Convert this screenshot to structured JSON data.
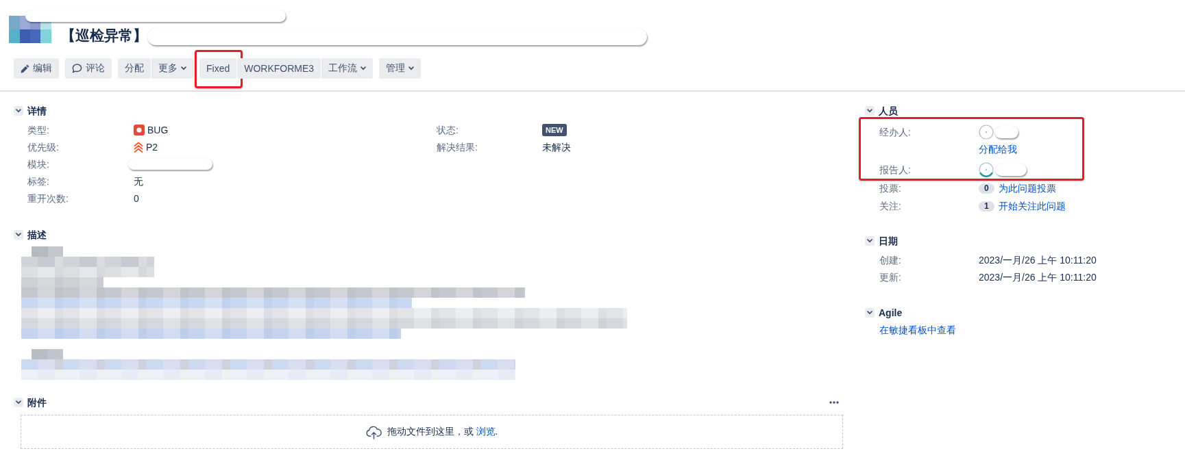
{
  "issue": {
    "title": "【巡检异常】"
  },
  "toolbar": {
    "groups": [
      {
        "buttons": [
          {
            "kind": "edit",
            "label": "编辑",
            "highlighted": false
          }
        ]
      },
      {
        "buttons": [
          {
            "kind": "comment",
            "label": "评论",
            "highlighted": false
          }
        ]
      },
      {
        "buttons": [
          {
            "kind": "plain",
            "label": "分配",
            "highlighted": false
          },
          {
            "kind": "dropdown",
            "label": "更多",
            "highlighted": false
          }
        ]
      },
      {
        "buttons": [
          {
            "kind": "plain",
            "label": "Fixed",
            "highlighted": true
          },
          {
            "kind": "plain",
            "label": "WORKFORME3",
            "highlighted": false
          },
          {
            "kind": "dropdown",
            "label": "工作流",
            "highlighted": false
          }
        ]
      },
      {
        "buttons": [
          {
            "kind": "dropdown",
            "label": "管理",
            "highlighted": false
          }
        ]
      }
    ]
  },
  "details": {
    "title": "详情",
    "expanded": true,
    "left_fields": [
      {
        "label": "类型:",
        "kind": "issue_type",
        "value": "BUG"
      },
      {
        "label": "优先级:",
        "kind": "priority",
        "value": "P2"
      },
      {
        "label": "模块:",
        "kind": "redacted"
      },
      {
        "label": "标签:",
        "kind": "text",
        "value": "无"
      },
      {
        "label": "重开次数:",
        "kind": "text",
        "value": "0"
      }
    ],
    "right_fields": [
      {
        "label": "状态:",
        "kind": "lozenge",
        "value": "NEW"
      },
      {
        "label": "解决结果:",
        "kind": "text",
        "value": "未解决"
      }
    ]
  },
  "description": {
    "title": "描述",
    "expanded": true
  },
  "attachments": {
    "title": "附件",
    "expanded": true,
    "dropzone": {
      "text": "拖动文件到这里，或",
      "link": "浏览."
    }
  },
  "people": {
    "title": "人员",
    "expanded": true,
    "highlighted": true,
    "assignee": {
      "label": "经办人:",
      "action": "分配给我"
    },
    "reporter": {
      "label": "报告人:"
    },
    "votes": {
      "label": "投票:",
      "count": "0",
      "action": "为此问题投票"
    },
    "watchers": {
      "label": "关注:",
      "count": "1",
      "action": "开始关注此问题"
    }
  },
  "dates": {
    "title": "日期",
    "expanded": true,
    "fields": [
      {
        "label": "创建:",
        "value": "2023/一月/26 上午 10:11:20"
      },
      {
        "label": "更新:",
        "value": "2023/一月/26 上午 10:11:20"
      }
    ]
  },
  "agile": {
    "title": "Agile",
    "expanded": true,
    "link": "在敏捷看板中查看"
  }
}
